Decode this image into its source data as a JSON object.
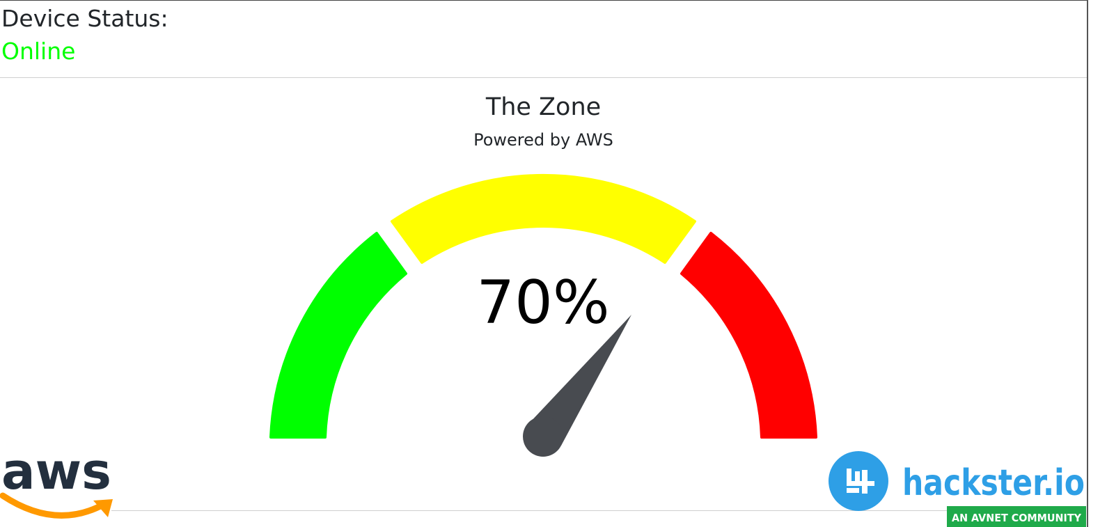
{
  "device_status": {
    "title": "Device Status:",
    "value": "Online",
    "value_color": "#00ff00"
  },
  "gauge": {
    "title": "The Zone",
    "subtitle": "Powered by AWS",
    "value_text": "70%",
    "value_fraction": 0.7,
    "zones": [
      {
        "name": "green",
        "color": "#00ff00"
      },
      {
        "name": "yellow",
        "color": "#ffff00"
      },
      {
        "name": "red",
        "color": "#ff0000"
      }
    ],
    "needle_color": "#484b50"
  },
  "logos": {
    "aws": {
      "text": "aws",
      "icon": "amazon-smile-arrow",
      "text_color": "#232f3e",
      "arrow_color": "#ff9900"
    },
    "hackster": {
      "text": "hackster.io",
      "tagline": "AN AVNET COMMUNITY",
      "color": "#2e9fe6",
      "tag_color": "#1faa4a"
    }
  }
}
